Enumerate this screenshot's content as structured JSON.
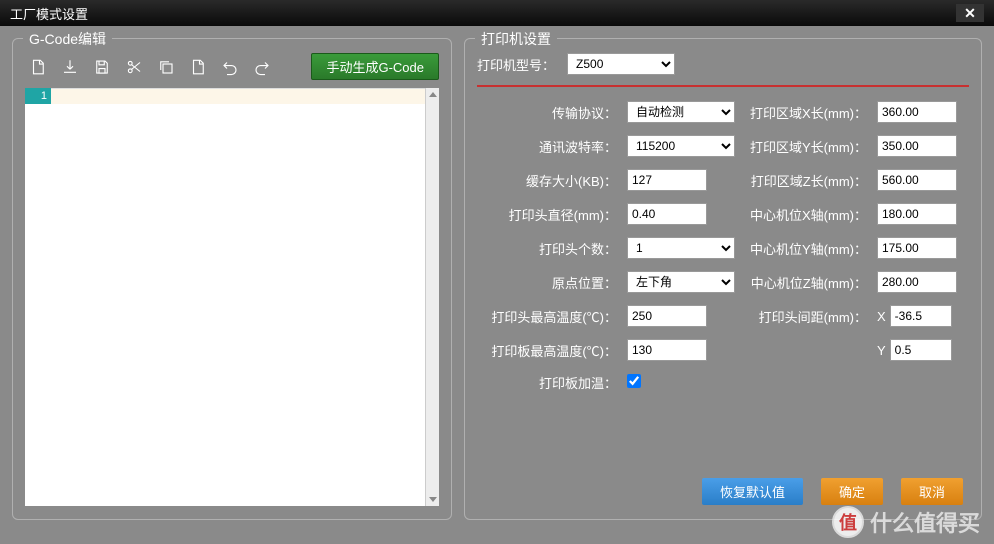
{
  "title": "工厂模式设置",
  "gcode": {
    "legend": "G-Code编辑",
    "generate_btn": "手动生成G-Code",
    "line1": "1"
  },
  "printer": {
    "legend": "打印机设置",
    "model_label": "打印机型号：",
    "model_value": "Z500",
    "left": {
      "protocol_label": "传输协议：",
      "protocol_value": "自动检测",
      "baud_label": "通讯波特率：",
      "baud_value": "115200",
      "cache_label": "缓存大小(KB)：",
      "cache_value": "127",
      "head_diam_label": "打印头直径(mm)：",
      "head_diam_value": "0.40",
      "head_count_label": "打印头个数：",
      "head_count_value": "1",
      "origin_label": "原点位置：",
      "origin_value": "左下角",
      "head_maxtemp_label": "打印头最高温度(℃)：",
      "head_maxtemp_value": "250",
      "bed_maxtemp_label": "打印板最高温度(℃)：",
      "bed_maxtemp_value": "130",
      "bed_heat_label": "打印板加温："
    },
    "right": {
      "area_x_label": "打印区域X长(mm)：",
      "area_x_value": "360.00",
      "area_y_label": "打印区域Y长(mm)：",
      "area_y_value": "350.00",
      "area_z_label": "打印区域Z长(mm)：",
      "area_z_value": "560.00",
      "center_x_label": "中心机位X轴(mm)：",
      "center_x_value": "180.00",
      "center_y_label": "中心机位Y轴(mm)：",
      "center_y_value": "175.00",
      "center_z_label": "中心机位Z轴(mm)：",
      "center_z_value": "280.00",
      "head_gap_label": "打印头间距(mm)：",
      "head_gap_x_prefix": "X",
      "head_gap_x_value": "-36.5",
      "head_gap_y_prefix": "Y",
      "head_gap_y_value": "0.5"
    }
  },
  "buttons": {
    "restore": "恢复默认值",
    "ok": "确定",
    "cancel": "取消"
  },
  "watermark": {
    "badge": "值",
    "text": "什么值得买"
  }
}
